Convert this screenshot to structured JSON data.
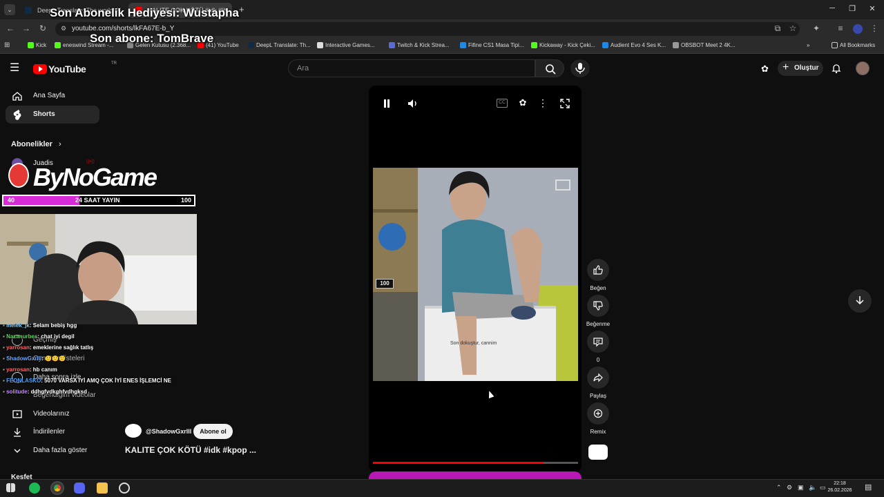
{
  "browser": {
    "tabs": [
      {
        "title": "DeepL Translate: The world's",
        "active": false
      },
      {
        "title": "KALITE ÇOK KÖTÜ #idk #k",
        "active": true
      }
    ],
    "url": "youtube.com/shorts/lkFA67E-b_Y",
    "bookmarks": [
      "Kick",
      "eneswind Stream -...",
      "Gelen Kutusu (2.368...",
      "(41) YouTube",
      "DeepL Translate: Th...",
      "Interactive Games...",
      "Twitch & Kick Strea...",
      "Fifine CS1 Masa Tipi...",
      "Kickaway - Kick Çeki...",
      "Audient Evo 4 Ses K...",
      "OBSBOT Meet 2 4K..."
    ],
    "all_bookmarks": "All Bookmarks"
  },
  "overlay": {
    "last_gift": "Son Abonelik Hediyesi: Wustapha",
    "last_sub": "Son abone: TomBrave",
    "brand": "ByNoGame",
    "goal_label": "24 SAAT YAYIN",
    "goal_current": "40",
    "goal_target": "100",
    "goal_fraction": 0.4
  },
  "youtube": {
    "logo": "YouTube",
    "logo_region": "TR",
    "search_placeholder": "Ara",
    "create_label": "Oluştur",
    "sidebar": {
      "home": "Ana Sayfa",
      "shorts": "Shorts",
      "subs_heading": "Abonelikler",
      "sub_channel": "Juadis",
      "history": "Geçmiş",
      "playlists": "Oynatma listeleri",
      "watch_later": "Daha sonra izle",
      "liked": "Beğendiğim videolar",
      "your_videos": "Videolarınız",
      "downloads": "İndirilenler",
      "show_more": "Daha fazla göster",
      "explore": "Keşfet"
    },
    "short": {
      "channel": "@ShadowGxrlll",
      "subscribe": "Abone ol",
      "title": "KALITE ÇOK KÖTÜ #idk #kpop ...",
      "caption": "Son dokuştur, cannim",
      "video_badge": "100",
      "progress_fraction": 0.83,
      "actions": {
        "like": "Beğen",
        "dislike": "Beğenme",
        "comments": "0",
        "share": "Paylaş",
        "remix": "Remix"
      }
    }
  },
  "chat": [
    {
      "user": "melek_jk",
      "msg": ": Selam bebiş hgg",
      "color": "#7fd0ff"
    },
    {
      "user": "Nazanurbes",
      "msg": ": chat iyi degil",
      "color": "#5fd35f"
    },
    {
      "user": "yarrosan",
      "msg": ": emeklerine sağlık tatlış",
      "color": "#ff6b6b"
    },
    {
      "user": "ShadowGxrlll",
      "msg": ": 🙂🙂🙂",
      "color": "#6fa8ff"
    },
    {
      "user": "yarrosan",
      "msg": ": hb canım",
      "color": "#ff6b6b"
    },
    {
      "user": "FEONLASKO",
      "msg": ": 5070 VARSA İYİ AMQ ÇOK İYİ ENES İŞLEMCİ NE",
      "color": "#4aa3ff"
    },
    {
      "user": "solitude",
      "msg": ": ddhgfvdkghfvdhgksd",
      "color": "#c58cff"
    }
  ],
  "taskbar": {
    "time": "22:18",
    "date": "26.02.2026"
  }
}
